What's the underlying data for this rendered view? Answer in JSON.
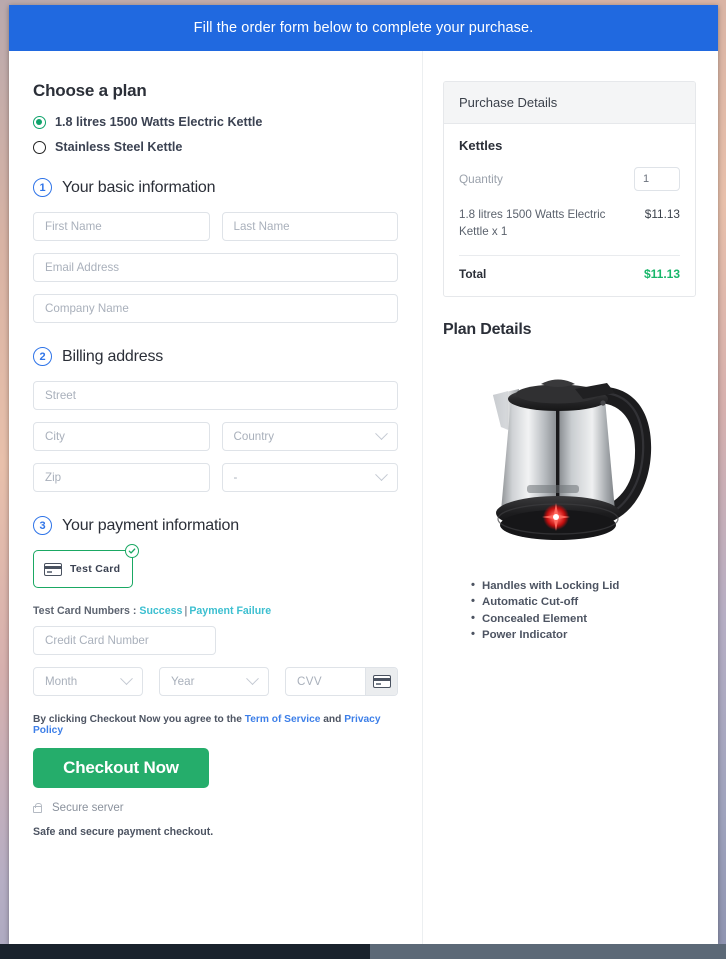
{
  "banner": {
    "message": "Fill the order form below to complete your purchase."
  },
  "left": {
    "plan_section_title": "Choose a plan",
    "plans": [
      {
        "label": "1.8 litres 1500 Watts Electric Kettle",
        "selected": true
      },
      {
        "label": "Stainless Steel Kettle",
        "selected": false
      }
    ],
    "step1": {
      "number": "1",
      "title": "Your basic information",
      "first_name_placeholder": "First Name",
      "last_name_placeholder": "Last Name",
      "email_placeholder": "Email Address",
      "company_placeholder": "Company Name"
    },
    "step2": {
      "number": "2",
      "title": "Billing address",
      "street_placeholder": "Street",
      "city_placeholder": "City",
      "country_placeholder": "Country",
      "zip_placeholder": "Zip",
      "state_placeholder": "-"
    },
    "step3": {
      "number": "3",
      "title": "Your payment information",
      "method_label": "Test Card",
      "test_cards_prefix": "Test Card Numbers :",
      "test_card_success": "Success",
      "test_card_separator": "|",
      "test_card_failure": "Payment Failure",
      "card_number_placeholder": "Credit Card Number",
      "month_placeholder": "Month",
      "year_placeholder": "Year",
      "cvv_placeholder": "CVV"
    },
    "terms": {
      "prefix": "By clicking Checkout Now you agree to the",
      "tos_link": "Term of Service",
      "conjunction": "and",
      "privacy_link": "Privacy Policy"
    },
    "checkout_button": "Checkout Now",
    "secure_server": "Secure server",
    "safe_note": "Safe and secure payment checkout."
  },
  "right": {
    "purchase_details_title": "Purchase Details",
    "product_group": "Kettles",
    "quantity_label": "Quantity",
    "quantity_value": "1",
    "line_item_name": "1.8 litres 1500 Watts Electric Kettle x 1",
    "line_item_price": "$11.13",
    "total_label": "Total",
    "total_value": "$11.13",
    "plan_details_title": "Plan Details",
    "features": [
      "Handles with Locking Lid",
      "Automatic Cut-off",
      "Concealed Element",
      "Power Indicator"
    ]
  },
  "colors": {
    "banner_blue": "#2069e0",
    "accent_green": "#25ad6b",
    "total_green": "#18b66a",
    "step_blue": "#2f74e8",
    "link_blue": "#3d7fe8",
    "link_teal": "#3cbfd0"
  }
}
